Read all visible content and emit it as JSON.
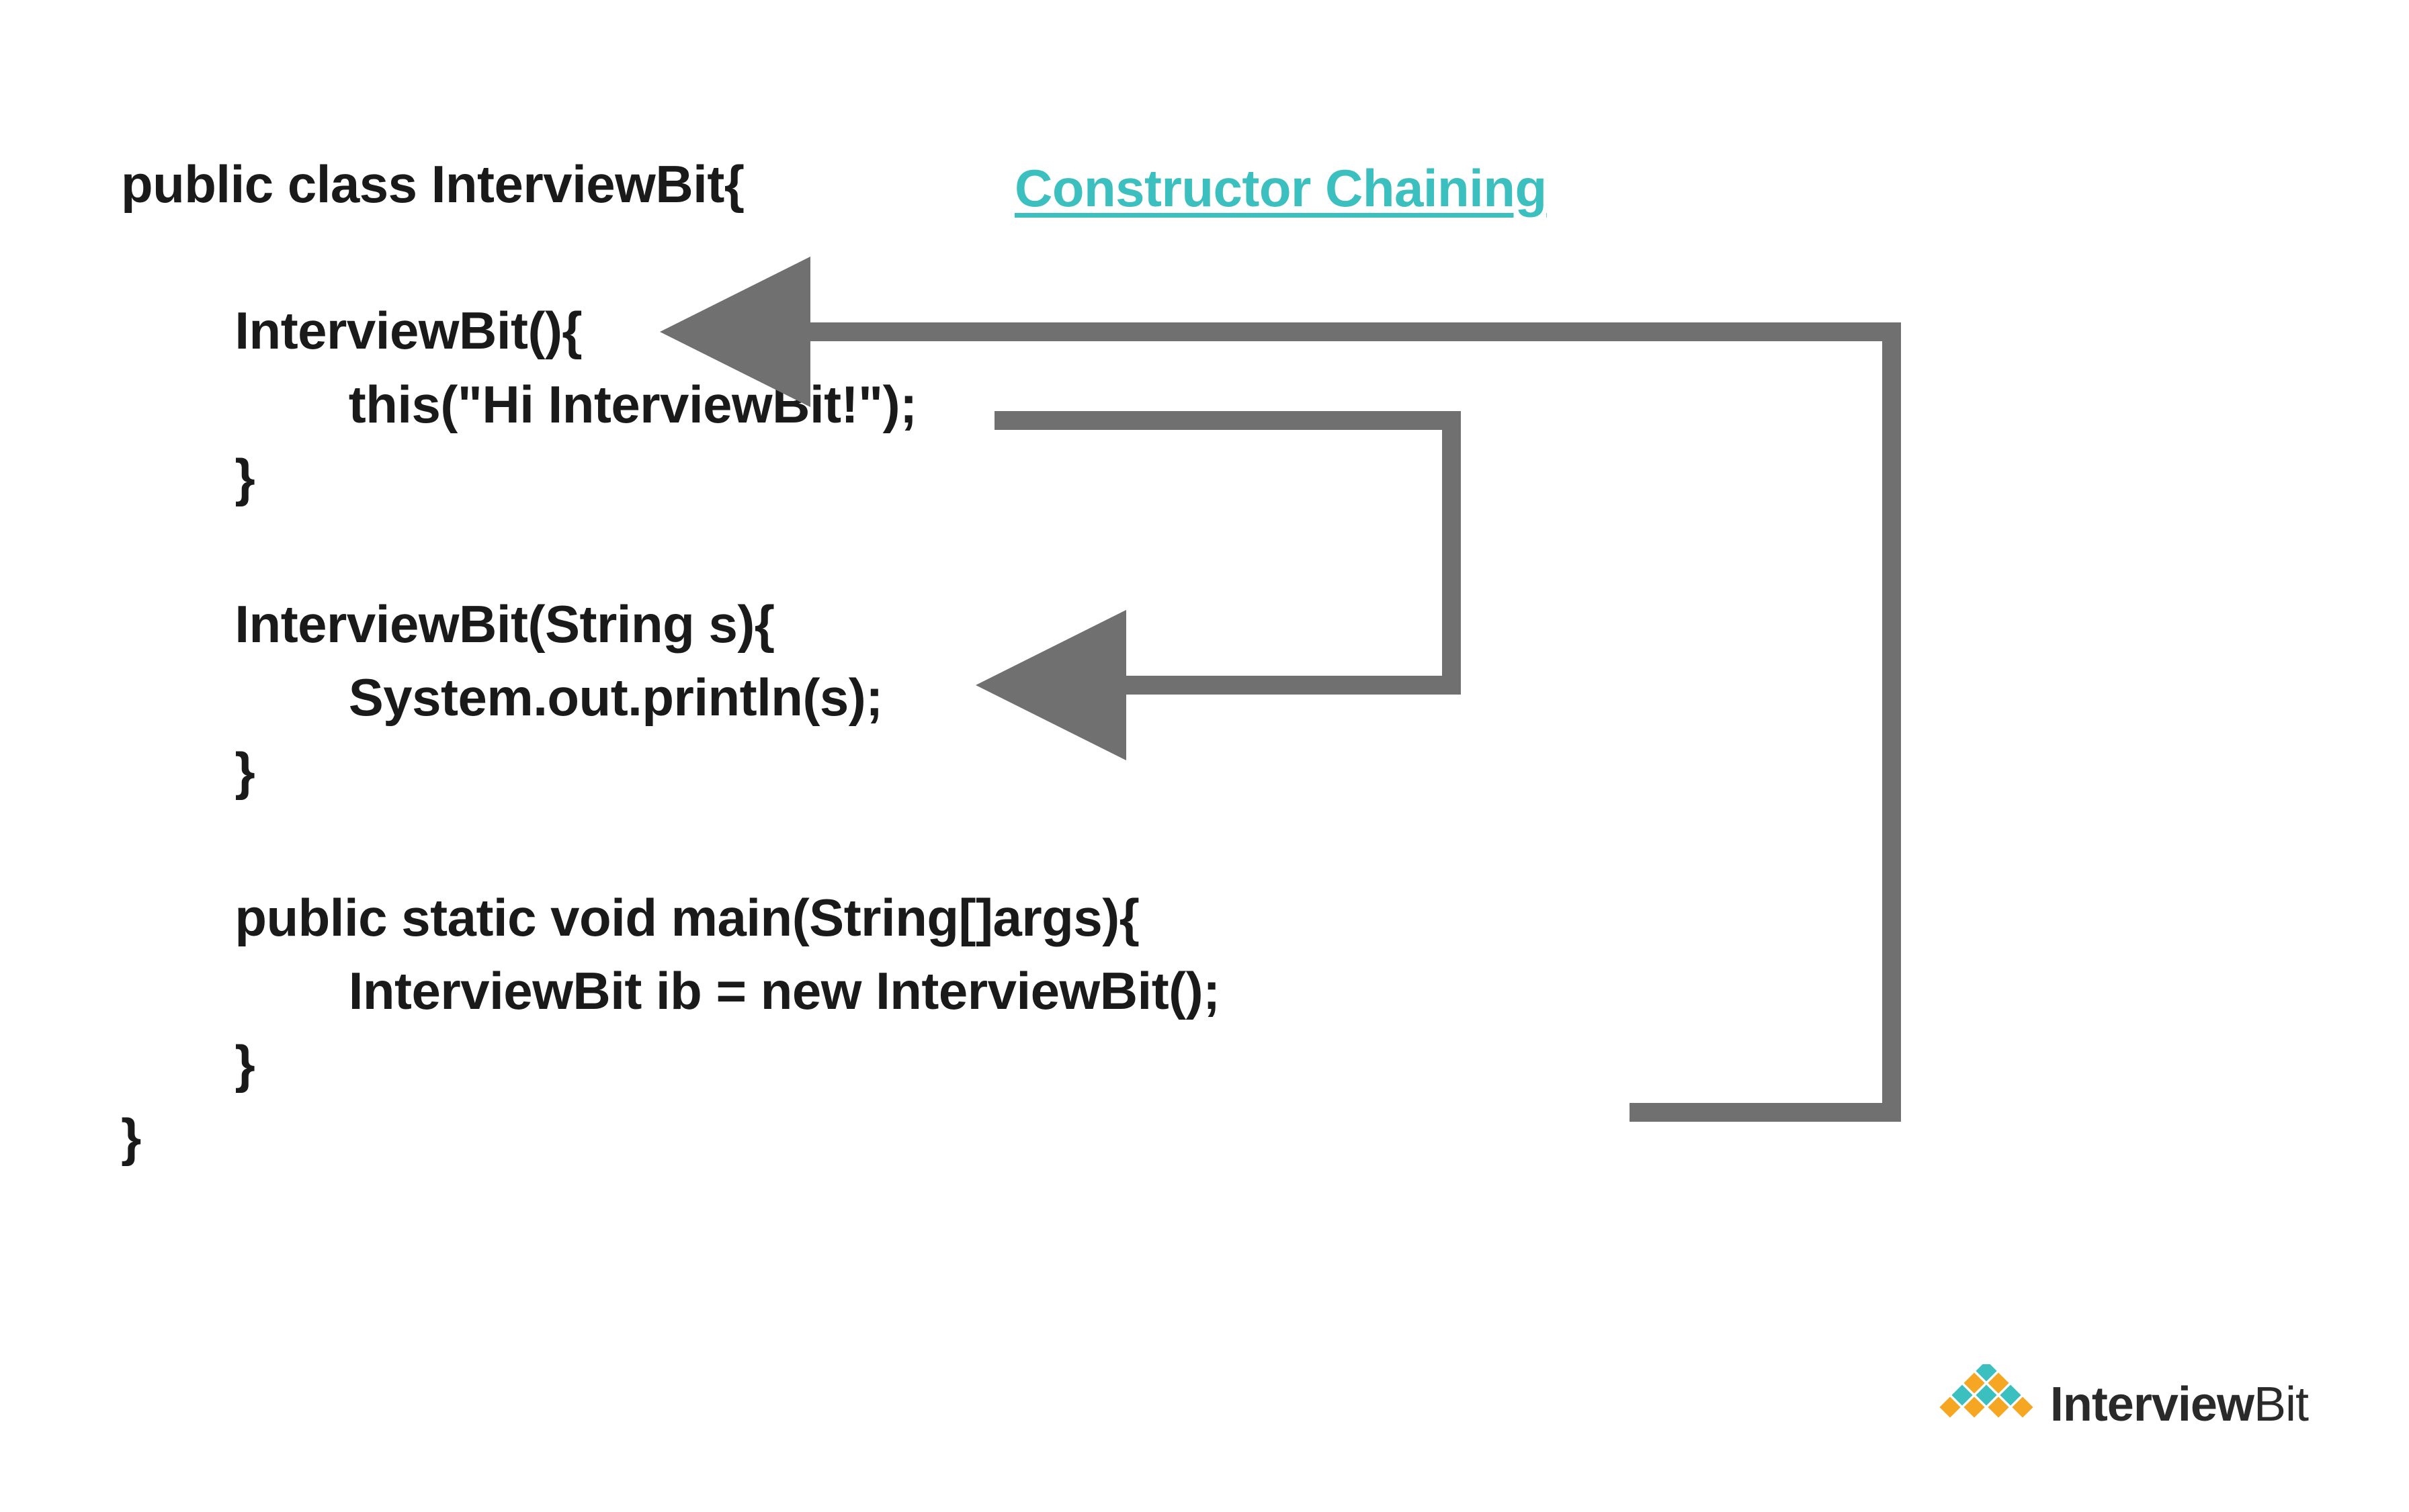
{
  "heading": "Constructor Chaining",
  "code": {
    "classDecl": "public class InterviewBit{",
    "ctor1_sig": "InterviewBit(){",
    "ctor1_body": "this(\"Hi InterviewBit!\");",
    "close1": "}",
    "ctor2_sig": "InterviewBit(String s){",
    "ctor2_body": "System.out.println(s);",
    "close2": "}",
    "main_sig": "public static void main(String[]args){",
    "main_body": "InterviewBit ib = new InterviewBit();",
    "close3": "}",
    "classClose": "}"
  },
  "logo": {
    "brand1": "Interview",
    "brand2": "Bit"
  },
  "colors": {
    "heading": "#3bbfbf",
    "arrow": "#707070",
    "text": "#1a1a1a",
    "logoTeal": "#3bbfbf",
    "logoOrange": "#f5a623"
  },
  "arrows": [
    {
      "from": "main_body new InterviewBit()",
      "to": "ctor1_sig InterviewBit()"
    },
    {
      "from": "ctor1_body this(...)",
      "to": "ctor2_sig InterviewBit(String s)"
    }
  ]
}
